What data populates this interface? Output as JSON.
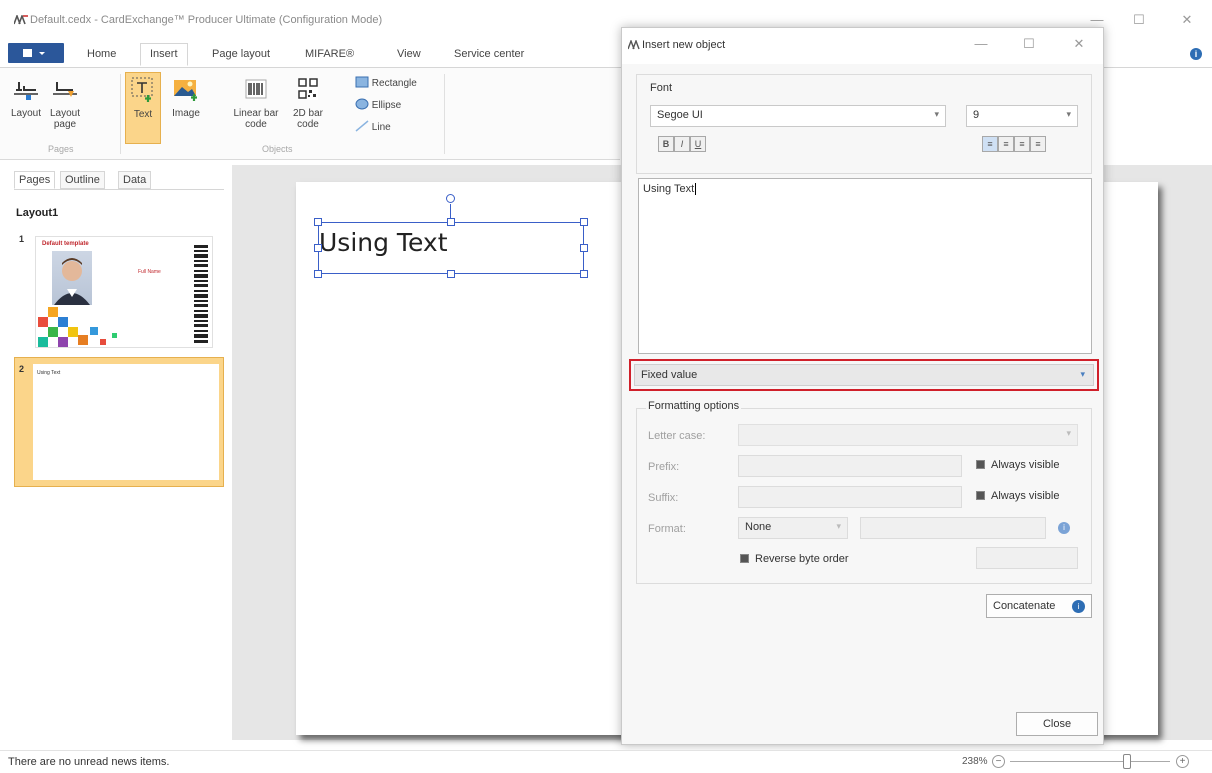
{
  "window": {
    "title": "Default.cedx - CardExchange™ Producer Ultimate (Configuration Mode)",
    "minimize_icon": "—",
    "maximize_icon": "☐",
    "close_icon": "✕"
  },
  "ribbon": {
    "file_label": "",
    "tabs": [
      "Home",
      "Insert",
      "Page layout",
      "MIFARE®",
      "View",
      "Service center"
    ],
    "active_tab": "Insert",
    "help_icon": "i",
    "groups": {
      "pages": {
        "label": "Pages",
        "layout": "Layout",
        "layout_page_1": "Layout",
        "layout_page_2": "page"
      },
      "objects": {
        "label": "Objects",
        "text": "Text",
        "image": "Image",
        "linear_1": "Linear bar",
        "linear_2": "code",
        "twod_1": "2D bar",
        "twod_2": "code",
        "rectangle": "Rectangle",
        "ellipse": "Ellipse",
        "line": "Line"
      }
    }
  },
  "left_panel": {
    "tabs": [
      "Pages",
      "Outline",
      "Data"
    ],
    "layout_name": "Layout1",
    "pages": [
      {
        "number": "1",
        "card_title": "Default template",
        "card_name": "Full Name"
      },
      {
        "number": "2",
        "card_text": "Using Text"
      }
    ]
  },
  "canvas": {
    "text": "Using Text"
  },
  "dialog": {
    "title": "Insert new object",
    "font_label": "Font",
    "font_name": "Segoe UI",
    "font_size": "9",
    "style_buttons": [
      "B",
      "I",
      "U"
    ],
    "text_value": "Using Text",
    "source_select": "Fixed value",
    "formatting_title": "Formatting options",
    "letter_case_label": "Letter case:",
    "prefix_label": "Prefix:",
    "suffix_label": "Suffix:",
    "always_visible": "Always visible",
    "format_label": "Format:",
    "format_value": "None",
    "reverse_byte_order": "Reverse byte order",
    "concatenate": "Concatenate",
    "close": "Close"
  },
  "status": {
    "news": "There are no unread news items.",
    "zoom": "238%"
  },
  "colors": {
    "accent": "#2b579a",
    "selected_tab": "#fbd58a",
    "highlight_border": "#d0202a",
    "handle": "#3a5fc8"
  }
}
